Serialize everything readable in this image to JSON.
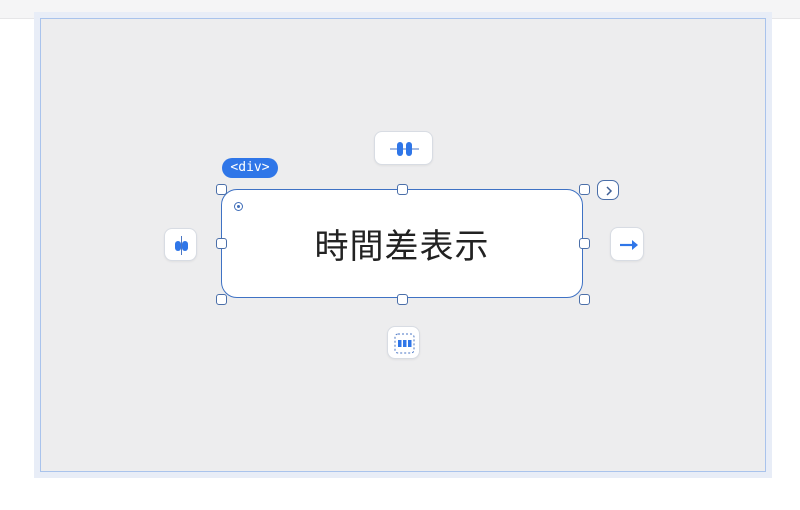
{
  "element": {
    "tag_label": "<div>",
    "text": "時間差表示"
  },
  "icons": {
    "top": "align-vertical-center-icon",
    "left": "align-horizontal-center-icon",
    "right": "arrow-right-icon",
    "bottom": "distribute-spacing-icon",
    "next": "chevron-right-icon"
  },
  "colors": {
    "accent": "#2f76e8",
    "selection": "#3f72c4",
    "canvas": "#ededee"
  }
}
